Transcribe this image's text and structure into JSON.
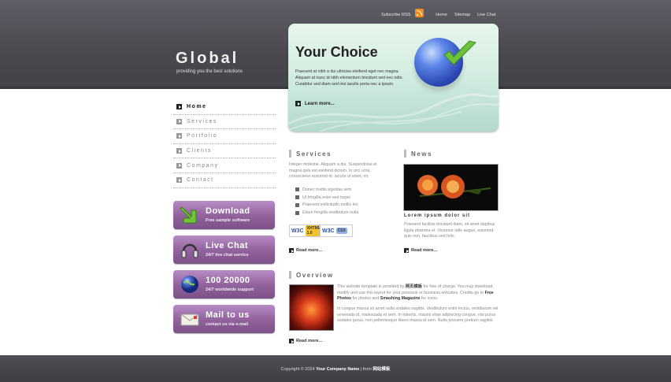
{
  "topnav": {
    "rss": "Subscribe RSS",
    "links": [
      "Home",
      "Sitemap",
      "Live Chat"
    ]
  },
  "site": {
    "logo": "Global",
    "tagline": "providing you the best solutions"
  },
  "feature": {
    "title": "Your Choice",
    "text": "Praesent at nibh a dui ultricies eleifend eget nec magna. Aliquam at nunc id nibh elementum tincidunt sed nec odio. Curabitur sed diam sed nisi iaculis porta nec a ipsum.",
    "more": "Learn more..."
  },
  "sidebar": {
    "items": [
      "Home",
      "Services",
      "Portfolio",
      "Clients",
      "Company",
      "Contact"
    ]
  },
  "promo": [
    {
      "title": "Download",
      "sub": "Free sample software",
      "icon": "download-arrow-icon"
    },
    {
      "title": "Live Chat",
      "sub": "24/7 live chat service",
      "icon": "headset-icon"
    },
    {
      "title": "100 20000",
      "sub": "24/7 worldwide support",
      "icon": "globe-icon"
    },
    {
      "title": "Mail to us",
      "sub": "contact us via e-mail",
      "icon": "envelope-icon"
    }
  ],
  "services": {
    "title": "Services",
    "text": "Integer molestie. Aliquam a dui. Suspendisse et magna quis est eleifend dictum. In orci urna, consectetur euismod et, iaculis ut amet, mi.",
    "list": [
      "Donec mattis egestas sem",
      "Ut fringilla enim sed turpis",
      "Praesent sollicitudin mollis leo",
      "Etiam fringilla vestibulum nulla"
    ],
    "badge_xhtml": "XHTML 1.0",
    "badge_css": "CSS",
    "badge_w3c": "W3C",
    "more": "Read more..."
  },
  "news": {
    "title": "News",
    "caption": "Lorem ipsum dolor sit",
    "text": "Praesent facilisis tincidunt diam, sit amet dapibus ligula pharetra et. Vivamus odio augue, euismod quis non, faucibus sed felis.",
    "more": "Read more..."
  },
  "overview": {
    "title": "Overview",
    "p1_a": "This website template is provided by",
    "p1_brand": "网页模板",
    "p1_b": "for free of charge. You may download, modify and use this layout for your personal or business websites. Credits go to",
    "p1_free": "Free Photos",
    "p1_c": "for photos and",
    "p1_sm": "Smashing Magazine",
    "p1_d": "for icons.",
    "p2": "In congue massa sit amet nulla sodales sagittis. Vestibulum enim lectus, vestibulum vel venenatis id, malesuada et sem. In lobortis, mauris vitae adipiscing congue, nisi purus sodales purus, non pellentesque libero massa id sem. Nulla posuere pretium sagittis.",
    "more": "Read more..."
  },
  "footer": {
    "copy": "Copyright © 2024",
    "company": "Your Company Name",
    "from": "| from",
    "brand": "网站模板"
  }
}
